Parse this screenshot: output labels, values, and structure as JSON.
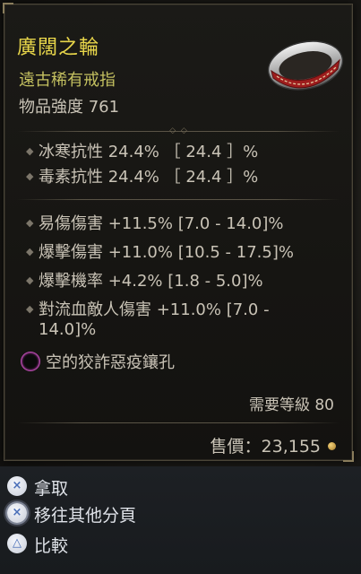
{
  "item": {
    "name": "廣闊之輪",
    "rarity": "遠古稀有戒指",
    "item_power": "物品強度 761",
    "implicit_stats": [
      "冰寒抗性 24.4% ［ 24.4 ］%",
      "毒素抗性 24.4% ［ 24.4 ］%"
    ],
    "affixes": [
      "易傷傷害 +11.5% [7.0 - 14.0]%",
      "爆擊傷害 +11.0% [10.5 - 17.5]%",
      "爆擊機率 +4.2% [1.8 - 5.0]%",
      "對流血敵人傷害 +11.0% [7.0 -",
      "14.0]%"
    ],
    "socket": "空的狡詐惡疫鑲孔",
    "required_level": "需要等級 80",
    "sell_price": "售價：23,155"
  },
  "controls": [
    {
      "label": "拿取",
      "button": "×"
    },
    {
      "label": "移往其他分頁",
      "button": "×"
    },
    {
      "label": "比較",
      "button": "△"
    }
  ],
  "colors": {
    "item_name": "#e8d64a",
    "rarity": "#c4c060",
    "text": "#c9c3b6",
    "socket": "#c24fb8"
  }
}
